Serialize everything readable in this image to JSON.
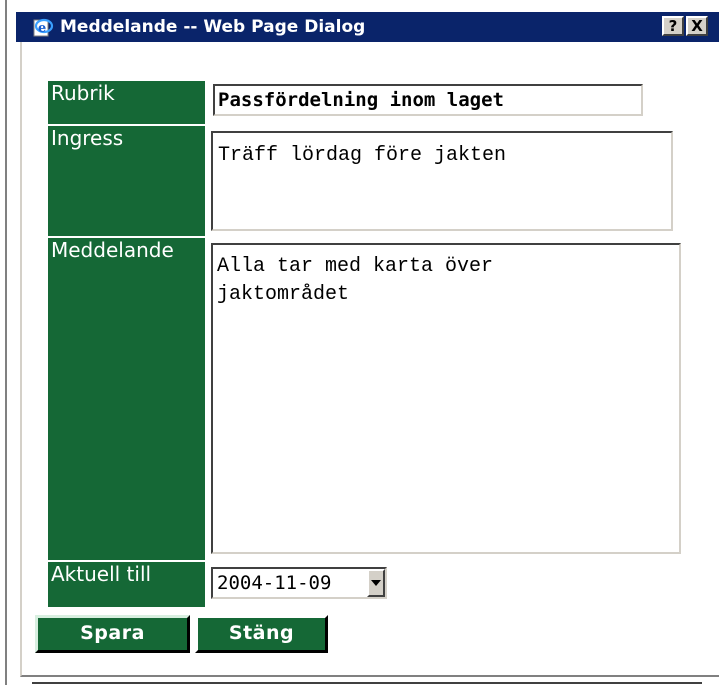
{
  "window": {
    "title": "Meddelande -- Web Page Dialog",
    "help_glyph": "?",
    "close_glyph": "X"
  },
  "form": {
    "rubrik": {
      "label": "Rubrik",
      "value": "Passfördelning inom laget"
    },
    "ingress": {
      "label": "Ingress",
      "value": "Träff lördag före jakten"
    },
    "meddelande": {
      "label": "Meddelande",
      "value": "Alla tar med karta över\njaktområdet"
    },
    "aktuell_till": {
      "label": "Aktuell till",
      "value": "2004-11-09"
    }
  },
  "buttons": {
    "save": "Spara",
    "close": "Stäng"
  },
  "colors": {
    "label_bg": "#156836",
    "titlebar_bg": "#0a246a"
  },
  "icons": {
    "title": "ie-page-icon",
    "dropdown": "chevron-down-icon"
  }
}
